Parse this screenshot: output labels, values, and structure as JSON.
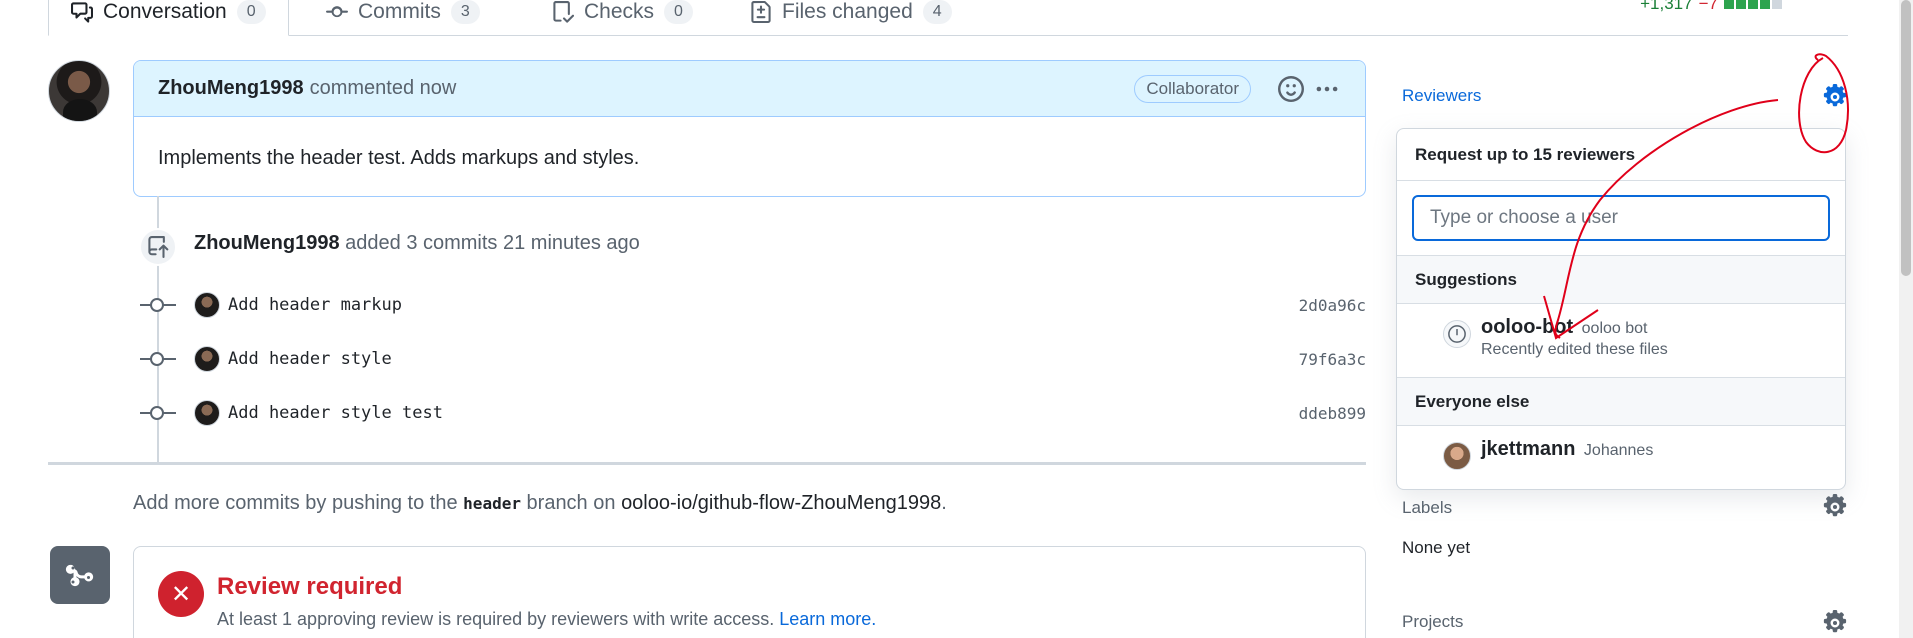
{
  "tabs": [
    {
      "label": "Conversation",
      "count": "0"
    },
    {
      "label": "Commits",
      "count": "3"
    },
    {
      "label": "Checks",
      "count": "0"
    },
    {
      "label": "Files changed",
      "count": "4"
    }
  ],
  "diffstat": {
    "additions": "+1,317",
    "deletions": "−7"
  },
  "comment": {
    "author": "ZhouMeng1998",
    "action": "commented now",
    "badge": "Collaborator",
    "body": "Implements the header test. Adds markups and styles."
  },
  "push_event": {
    "author": "ZhouMeng1998",
    "text": "added 3 commits 21 minutes ago"
  },
  "commits": [
    {
      "message": "Add header markup",
      "sha": "2d0a96c"
    },
    {
      "message": "Add header style",
      "sha": "79f6a3c"
    },
    {
      "message": "Add header style test",
      "sha": "ddeb899"
    }
  ],
  "hint": {
    "prefix": "Add more commits by pushing to the",
    "branch": "header",
    "middle": "branch on",
    "repo": "ooloo-io/github-flow-ZhouMeng1998",
    "suffix": "."
  },
  "merge": {
    "title": "Review required",
    "description": "At least 1 approving review is required by reviewers with write access.",
    "link": "Learn more."
  },
  "sidebar": {
    "reviewers_heading": "Reviewers",
    "labels_heading": "Labels",
    "labels_value": "None yet",
    "projects_heading": "Projects"
  },
  "reviewer_popup": {
    "header": "Request up to 15 reviewers",
    "placeholder": "Type or choose a user",
    "suggestions_heading": "Suggestions",
    "suggestion": {
      "login": "ooloo-bot",
      "name": "ooloo bot",
      "note": "Recently edited these files"
    },
    "everyone_heading": "Everyone else",
    "other_user": {
      "login": "jkettmann",
      "name": "Johannes"
    }
  },
  "colors": {
    "accent": "#0969da",
    "danger": "#cf222e",
    "annotation": "#e0001a"
  }
}
